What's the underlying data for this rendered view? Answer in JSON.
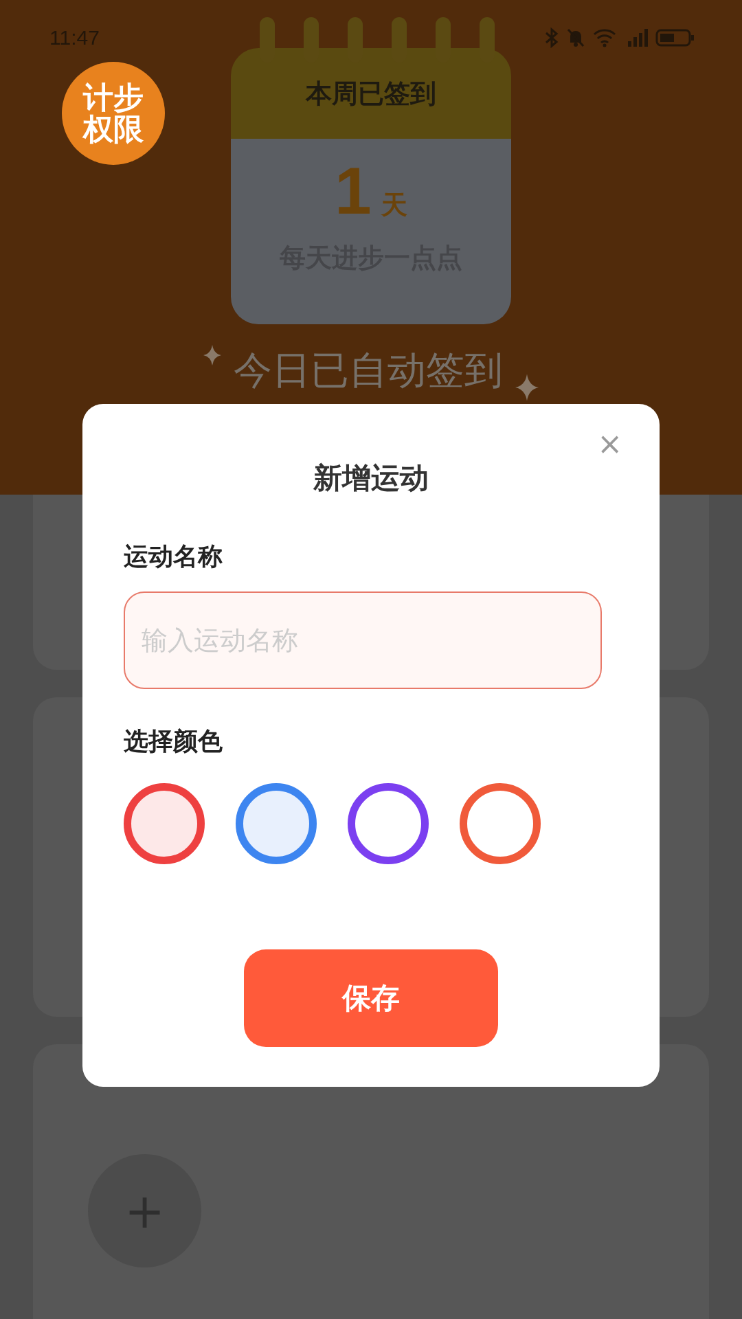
{
  "status_bar": {
    "time": "11:47"
  },
  "permission_badge": {
    "label": "计步权限"
  },
  "checkin_calendar": {
    "title": "本周已签到",
    "count": "1",
    "unit": "天",
    "slogan": "每天进步一点点"
  },
  "checkin_status": "今日已自动签到",
  "dialog": {
    "title": "新增运动",
    "close": "×",
    "name_label": "运动名称",
    "name_field": {
      "placeholder": "输入运动名称"
    },
    "color_label": "选择颜色",
    "colors": [
      {
        "color": "#ee4040",
        "filled": true
      },
      {
        "color": "#3d85f0",
        "filled": true
      },
      {
        "color": "#7b3ff0",
        "filled": false
      },
      {
        "color": "#f05a3a",
        "filled": false
      }
    ],
    "save_button": "保存"
  },
  "add_button": "+"
}
